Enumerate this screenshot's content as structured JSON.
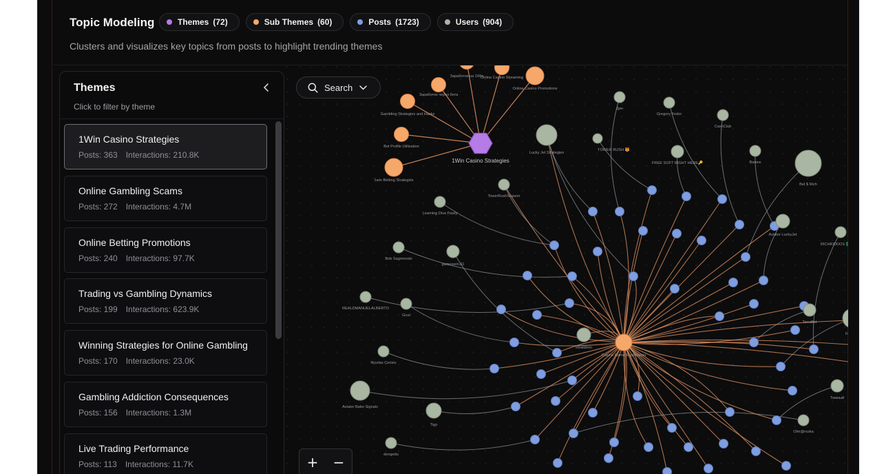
{
  "header": {
    "title": "Topic Modeling",
    "subtitle": "Clusters and visualizes key topics from posts to highlight trending themes",
    "chips": [
      {
        "label": "Themes",
        "count": "(72)",
        "color": "#b57be6"
      },
      {
        "label": "Sub Themes",
        "count": "(60)",
        "color": "#f6a86a"
      },
      {
        "label": "Posts",
        "count": "(1723)",
        "color": "#7f9ee0"
      },
      {
        "label": "Users",
        "count": "(904)",
        "color": "#a8b6a2"
      }
    ]
  },
  "panel": {
    "title": "Themes",
    "subtitle": "Click to filter by theme",
    "collapse_icon": "chevron-left-icon"
  },
  "themes": [
    {
      "name": "1Win Casino Strategies",
      "posts": "Posts: 363",
      "interactions": "Interactions: 210.8K",
      "active": true
    },
    {
      "name": "Online Gambling Scams",
      "posts": "Posts: 272",
      "interactions": "Interactions: 4.7M"
    },
    {
      "name": "Online Betting Promotions",
      "posts": "Posts: 240",
      "interactions": "Interactions: 97.7K"
    },
    {
      "name": "Trading vs Gambling Dynamics",
      "posts": "Posts: 199",
      "interactions": "Interactions: 623.9K"
    },
    {
      "name": "Winning Strategies for Online Gambling",
      "posts": "Posts: 170",
      "interactions": "Interactions: 23.0K"
    },
    {
      "name": "Gambling Addiction Consequences",
      "posts": "Posts: 156",
      "interactions": "Interactions: 1.3M"
    },
    {
      "name": "Live Trading Performance",
      "posts": "Posts: 113",
      "interactions": "Interactions: 11.7K"
    }
  ],
  "search": {
    "label": "Search",
    "icon": "search-icon",
    "dropdown_icon": "chevron-down-icon"
  },
  "zoom": {
    "in_label": "+",
    "out_label": "−"
  },
  "graph": {
    "colors": {
      "theme": "#b57be6",
      "subtheme": "#f6a86a",
      "post": "#7f9ee0",
      "user": "#a8b6a2",
      "edge_orange": "#e59462",
      "edge_gray": "#8a8f93",
      "label": "#9a9aa0"
    },
    "theme_node": {
      "label": "1Win Casino Strategies"
    },
    "subtheme_labels": [
      "Заработок на 1Win",
      "Online Casino Streaming",
      "Online Casino Promotions",
      "Заработок через бота",
      "Gambling Strategies and Hacks",
      "Bot Profile Utilization",
      "1win Betting Strategies",
      "Casino Game Exploitation"
    ],
    "user_labels": [
      "Дин",
      "Gregory Fedor",
      "CashClub",
      "Lucky Jet Strategies",
      "TOWER RUSH 🐯",
      "FREE SOFT RIGHT HERE🔑",
      "Валюх",
      "Bet $ Rich",
      "TowerRushSeason",
      "Learning Diva Fiasty",
      "Aviator LuckyJet",
      "RICHKIDDOS💲",
      "Bob Sagmonski",
      "gameswin.01",
      "REALDMANUELALBERTO",
      "Gcut",
      "TerraBet",
      "Fr",
      "Realdmin",
      "Nicolas Cerisio",
      "Aviator Babo Signals",
      "Tigo",
      "Темный",
      "Olm@rozka",
      "dengodu"
    ]
  }
}
